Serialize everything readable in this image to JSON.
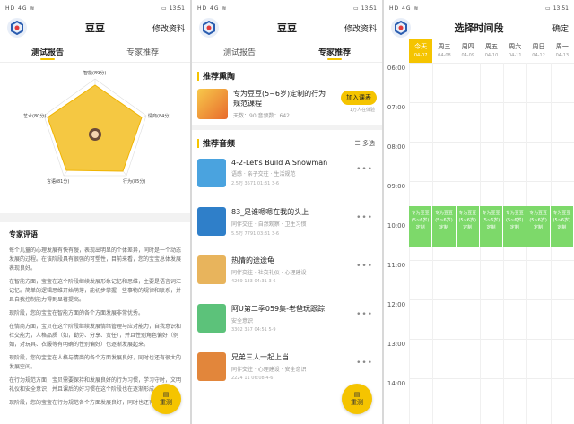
{
  "status": {
    "signal": "HD 4G ≋",
    "time": "13:51"
  },
  "panel1": {
    "title": "豆豆",
    "action": "修改资料",
    "tabs": [
      "测试报告",
      "专家推荐"
    ],
    "radar_labels": [
      "智能(89分)",
      "情商(84分)",
      "行为(85分)",
      "言语(81分)",
      "艺术(80分)"
    ],
    "comment_title": "专家评语",
    "paragraphs": [
      "每个儿童的心理发展有快有慢，表现出明显的个体差异，同时是一个动态发展的过程。在该阶段具有很强的可塑性，目前来看，您的宝宝总体发展表现良好。",
      "在智能方面，宝宝在这个阶段继续发展形象记忆和思维，主要是语言词汇记忆。简单的逻辑思维开始萌芽，能初步掌握一些事物的规律和联系，并且自我控制能力得到显著提高。",
      "现阶段，您的宝宝在智能方面的各个方面发展非常优秀。",
      "在情商方面，宝贝在这个阶段继续发展情绪管理与应对能力，自我意识和社交能力，人格品质（如，勤劳、分享、责任），并且性别角色偏好（例如，对玩具、衣服等有明确的性别偏好）也逐渐发展起来。",
      "现阶段，您的宝宝在人格与情商的各个方面发展良好，同时也还有很大的发展空间。",
      "在行为规范方面，宝贝需要保持和发展良好的行为习惯，学习守时，文明礼仪和安全意识，并且课后的好习惯在这个阶段也在逐渐形成。",
      "现阶段，您的宝宝在行为规范各个方面发展良好，同时也还有"
    ],
    "fab": "重测"
  },
  "panel2": {
    "title": "豆豆",
    "action": "修改资料",
    "tabs": [
      "测试报告",
      "专家推荐"
    ],
    "course_section": "推荐熏陶",
    "course": {
      "name": "专为豆豆(5~6岁)定制的行为规范课程",
      "meta": "天数：90  音频数：642",
      "join": "加入课表",
      "learned": "1万人在体验"
    },
    "audio_section": "推荐音频",
    "multi": "多选",
    "items": [
      {
        "name": "4-2-Let's Build A Snowman",
        "tags": "语感 · 亲子交往 · 生活规范",
        "stats": "2.5万  3571  01:31  3-6",
        "color": "#4aa3df"
      },
      {
        "name": "83_是谁嗯嗯在我的头上",
        "tags": "同伴交往 · 自然观察 · 卫生习惯",
        "stats": "5.5万  7791  03:31  3-6",
        "color": "#2f7fc9"
      },
      {
        "name": "热情的途途龟",
        "tags": "同伴交往 · 社交礼仪 · 心理建设",
        "stats": "4269  133  04:31  3-6",
        "color": "#e8b45c"
      },
      {
        "name": "阿U第二季059集-老爸玩跟踪",
        "tags": "安全意识",
        "stats": "3302  357  04:51  5-9",
        "color": "#5cc27a"
      },
      {
        "name": "兄弟三人一起上当",
        "tags": "同伴交往 · 心理建设 · 安全意识",
        "stats": "2224  11  06:08  4-6",
        "color": "#e2863b"
      }
    ],
    "fab": "重测"
  },
  "panel3": {
    "title": "选择时间段",
    "action": "确定",
    "days": [
      {
        "day": "今天",
        "date": "04-07",
        "today": true
      },
      {
        "day": "周三",
        "date": "04-08"
      },
      {
        "day": "周四",
        "date": "04-09"
      },
      {
        "day": "周五",
        "date": "04-10"
      },
      {
        "day": "周六",
        "date": "04-11"
      },
      {
        "day": "周日",
        "date": "04-12"
      },
      {
        "day": "周一",
        "date": "04-13"
      }
    ],
    "hours": [
      "06:00",
      "07:00",
      "08:00",
      "09:00",
      "10:00",
      "11:00",
      "12:00",
      "13:00",
      "14:00"
    ],
    "slot_text": "专为豆豆(5~6岁)定制"
  }
}
